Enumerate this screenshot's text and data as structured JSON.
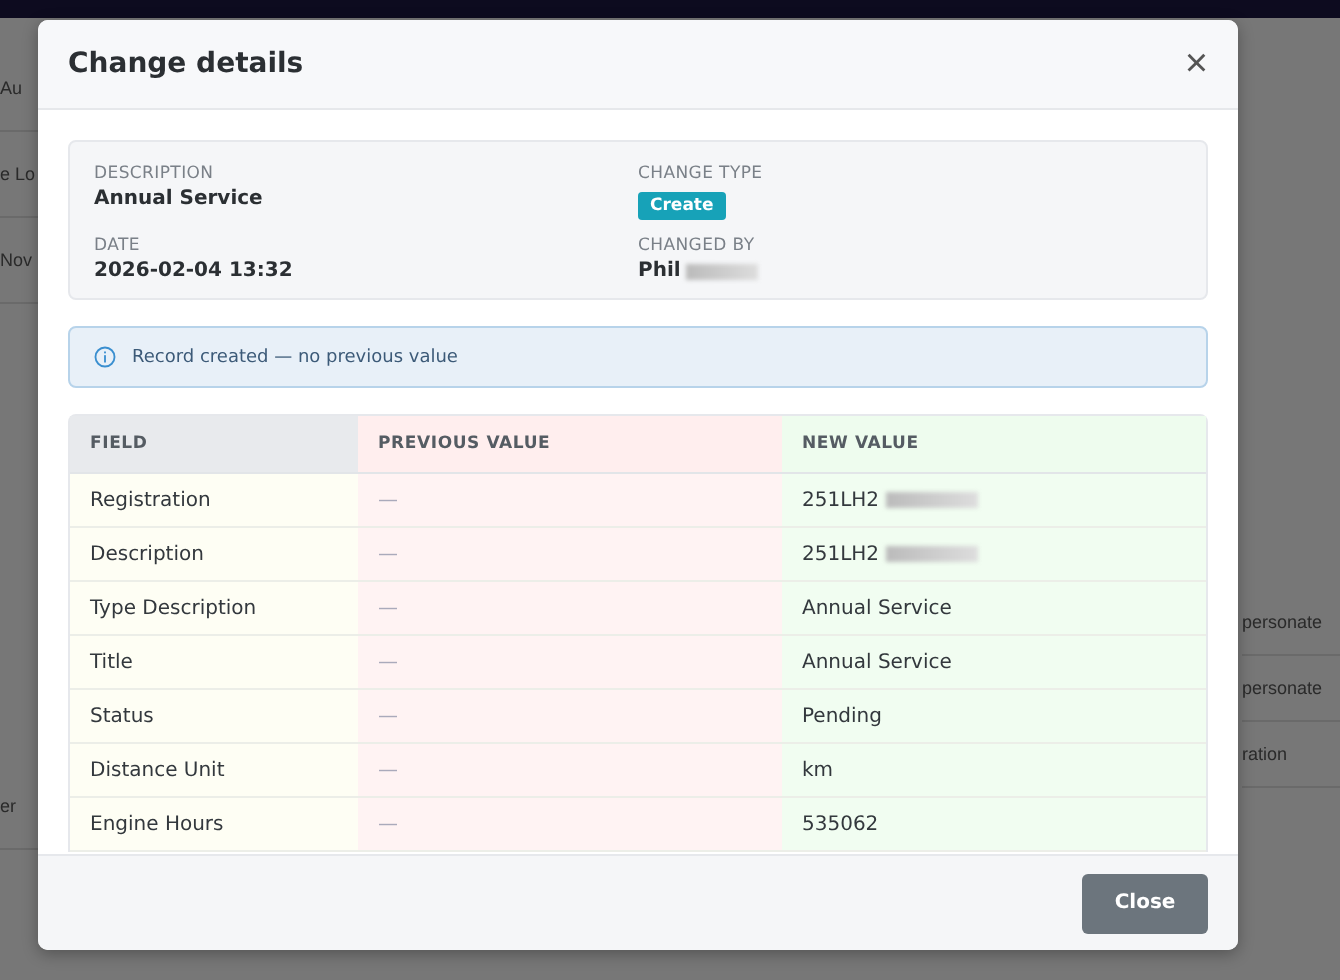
{
  "background": {
    "left_fragments": [
      "Au",
      "e Lo",
      "Nov",
      "er"
    ],
    "right_fragments": [
      "personate",
      "personate",
      "ration"
    ]
  },
  "dialog": {
    "title": "Change details",
    "close_icon": "×",
    "summary": [
      {
        "label": "DESCRIPTION",
        "value": "Annual Service",
        "kind": "text",
        "redacted": false
      },
      {
        "label": "CHANGE TYPE",
        "value": "Create",
        "kind": "badge",
        "redacted": false
      },
      {
        "label": "DATE",
        "value": "2026-02-04 13:32",
        "kind": "text",
        "redacted": false
      },
      {
        "label": "CHANGED BY",
        "value": "Phil",
        "kind": "text",
        "redacted": true
      }
    ],
    "notice": "Record created — no previous value",
    "table": {
      "columns": [
        "FIELD",
        "PREVIOUS VALUE",
        "NEW VALUE"
      ],
      "rows": [
        {
          "field": "Registration",
          "previous": "—",
          "new": "251LH2",
          "redacted": true
        },
        {
          "field": "Description",
          "previous": "—",
          "new": "251LH2",
          "redacted": true
        },
        {
          "field": "Type Description",
          "previous": "—",
          "new": "Annual Service",
          "redacted": false
        },
        {
          "field": "Title",
          "previous": "—",
          "new": "Annual Service",
          "redacted": false
        },
        {
          "field": "Status",
          "previous": "—",
          "new": "Pending",
          "redacted": false
        },
        {
          "field": "Distance Unit",
          "previous": "—",
          "new": "km",
          "redacted": false
        },
        {
          "field": "Engine Hours",
          "previous": "—",
          "new": "535062",
          "redacted": false
        }
      ]
    },
    "buttons": [
      "Close"
    ]
  }
}
